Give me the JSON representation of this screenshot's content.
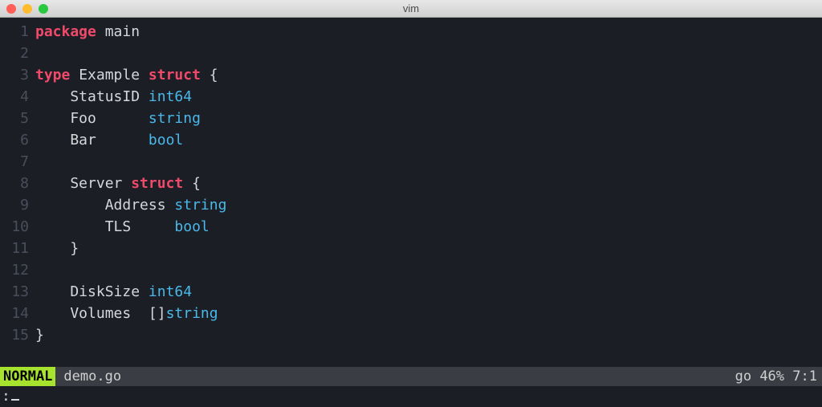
{
  "window": {
    "title": "vim"
  },
  "code": {
    "lines": [
      {
        "n": "1",
        "tokens": [
          [
            "kw",
            "package"
          ],
          [
            "ident",
            " "
          ],
          [
            "ident",
            "main"
          ]
        ]
      },
      {
        "n": "2",
        "tokens": []
      },
      {
        "n": "3",
        "tokens": [
          [
            "kw",
            "type"
          ],
          [
            "ident",
            " Example "
          ],
          [
            "kw",
            "struct"
          ],
          [
            "ident",
            " "
          ],
          [
            "punc",
            "{"
          ]
        ]
      },
      {
        "n": "4",
        "tokens": [
          [
            "ident",
            "    StatusID "
          ],
          [
            "type",
            "int64"
          ]
        ]
      },
      {
        "n": "5",
        "tokens": [
          [
            "ident",
            "    Foo      "
          ],
          [
            "type",
            "string"
          ]
        ]
      },
      {
        "n": "6",
        "tokens": [
          [
            "ident",
            "    Bar      "
          ],
          [
            "type",
            "bool"
          ]
        ]
      },
      {
        "n": "7",
        "tokens": []
      },
      {
        "n": "8",
        "tokens": [
          [
            "ident",
            "    Server "
          ],
          [
            "kw",
            "struct"
          ],
          [
            "ident",
            " "
          ],
          [
            "punc",
            "{"
          ]
        ]
      },
      {
        "n": "9",
        "tokens": [
          [
            "ident",
            "        Address "
          ],
          [
            "type",
            "string"
          ]
        ]
      },
      {
        "n": "10",
        "tokens": [
          [
            "ident",
            "        TLS     "
          ],
          [
            "type",
            "bool"
          ]
        ]
      },
      {
        "n": "11",
        "tokens": [
          [
            "ident",
            "    "
          ],
          [
            "punc",
            "}"
          ]
        ]
      },
      {
        "n": "12",
        "tokens": []
      },
      {
        "n": "13",
        "tokens": [
          [
            "ident",
            "    DiskSize "
          ],
          [
            "type",
            "int64"
          ]
        ]
      },
      {
        "n": "14",
        "tokens": [
          [
            "ident",
            "    Volumes  "
          ],
          [
            "punc",
            "[]"
          ],
          [
            "type",
            "string"
          ]
        ]
      },
      {
        "n": "15",
        "tokens": [
          [
            "punc",
            "}"
          ]
        ]
      }
    ]
  },
  "status": {
    "mode": "NORMAL",
    "filename": "demo.go",
    "filetype": "go",
    "percent": "46%",
    "position": "7:1"
  },
  "cmdline": {
    "prompt": ":"
  }
}
